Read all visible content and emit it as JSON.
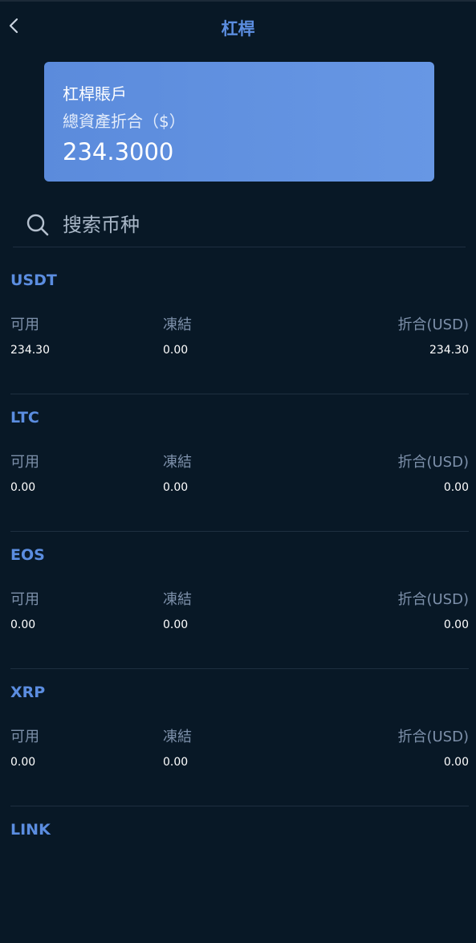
{
  "header": {
    "title": "杠桿",
    "back_icon": "chevron-left-icon"
  },
  "account_card": {
    "title": "杠桿賬戶",
    "subtitle": "總資產折合（$）",
    "total_value": "234.3000"
  },
  "search": {
    "placeholder": "搜索币种",
    "value": "",
    "icon": "search-icon"
  },
  "columns": {
    "available": "可用",
    "frozen": "凍結",
    "equivalent": "折合(USD)"
  },
  "assets": [
    {
      "name": "USDT",
      "available": "234.30",
      "frozen": "0.00",
      "equivalent": "234.30"
    },
    {
      "name": "LTC",
      "available": "0.00",
      "frozen": "0.00",
      "equivalent": "0.00"
    },
    {
      "name": "EOS",
      "available": "0.00",
      "frozen": "0.00",
      "equivalent": "0.00"
    },
    {
      "name": "XRP",
      "available": "0.00",
      "frozen": "0.00",
      "equivalent": "0.00"
    },
    {
      "name": "LINK"
    }
  ],
  "colors": {
    "background": "#081826",
    "accent": "#5b8de0",
    "card_gradient_start": "#5b8bdc",
    "card_gradient_end": "#6797e4",
    "label": "#7d90aa",
    "divider": "#1e2f40"
  }
}
